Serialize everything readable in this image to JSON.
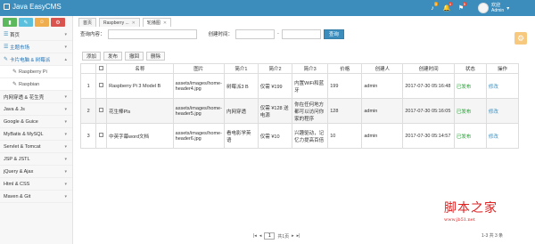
{
  "app": {
    "title": "Java EasyCMS"
  },
  "topbar": {
    "badges": [
      "3",
      "4",
      "5"
    ],
    "user": {
      "greeting": "欢迎",
      "name": "Admin"
    }
  },
  "sidebar": {
    "items": [
      {
        "label": "首页"
      },
      {
        "label": "主题市场"
      },
      {
        "label": "卡片电脑 & 树莓派"
      },
      {
        "label": "Raspberry Pi"
      },
      {
        "label": "Raspbian"
      },
      {
        "label": "内网穿透 & 花生壳"
      },
      {
        "label": "Java & Js"
      },
      {
        "label": "Google & Guice"
      },
      {
        "label": "MyBatis & MySQL"
      },
      {
        "label": "Servlet & Tomcat"
      },
      {
        "label": "JSP & JSTL"
      },
      {
        "label": "jQuery & Ajax"
      },
      {
        "label": "Html & CSS"
      },
      {
        "label": "Maven & Git"
      }
    ]
  },
  "tabs": [
    {
      "label": "首页"
    },
    {
      "label": "Raspberry ..."
    },
    {
      "label": "轮播图"
    }
  ],
  "search": {
    "content_label": "查询内容：",
    "time_label": "创建时间：",
    "separator": "-",
    "button_label": "查询",
    "content_value": "",
    "start_value": "",
    "end_value": ""
  },
  "toolbar": {
    "add": "添加",
    "publish": "发布",
    "revoke": "撤回",
    "delete": "删除"
  },
  "table": {
    "headers": [
      "",
      "",
      "名称",
      "图片",
      "简介1",
      "简介2",
      "简介3",
      "价格",
      "创建人",
      "创建时间",
      "状态",
      "操作"
    ],
    "rows": [
      {
        "no": "1",
        "name": "Raspberry Pi 3 Model B",
        "image": "assets/images/home-header4.jpg",
        "intro1": "树莓派3 B",
        "intro2": "仅需 ¥199",
        "intro3": "内置WiFi和蓝牙",
        "price": "199",
        "creator": "admin",
        "time": "2017-07-30 05:16:48",
        "status": "已发布",
        "action": "修改"
      },
      {
        "no": "2",
        "name": "花生棒Pls",
        "image": "assets/images/home-header5.jpg",
        "intro1": "内网穿透",
        "intro2": "仅需 ¥128 送电源",
        "intro3": "你在任何地方都可以访问你家的程序",
        "price": "128",
        "creator": "admin",
        "time": "2017-07-30 05:16:05",
        "status": "已发布",
        "action": "修改"
      },
      {
        "no": "3",
        "name": "中英字幕word文档",
        "image": "assets/images/home-header6.jpg",
        "intro1": "看电影学英语",
        "intro2": "仅需 ¥10",
        "intro3": "兴趣驱动，记忆力提高百倍",
        "price": "10",
        "creator": "admin",
        "time": "2017-07-30 05:14:57",
        "status": "已发布",
        "action": "修改"
      }
    ]
  },
  "pager": {
    "first": "|◂",
    "prev": "◂",
    "page": "1",
    "of": "共1页",
    "next": "▸",
    "last": "▸|",
    "count": "1-3 共 3 条"
  },
  "watermark": {
    "title": "脚本之家",
    "url": "www.jb51.net"
  },
  "colors": {
    "topbar": "#3c8dbc",
    "published": "#1a9c2a",
    "link": "#3c8dbc"
  }
}
